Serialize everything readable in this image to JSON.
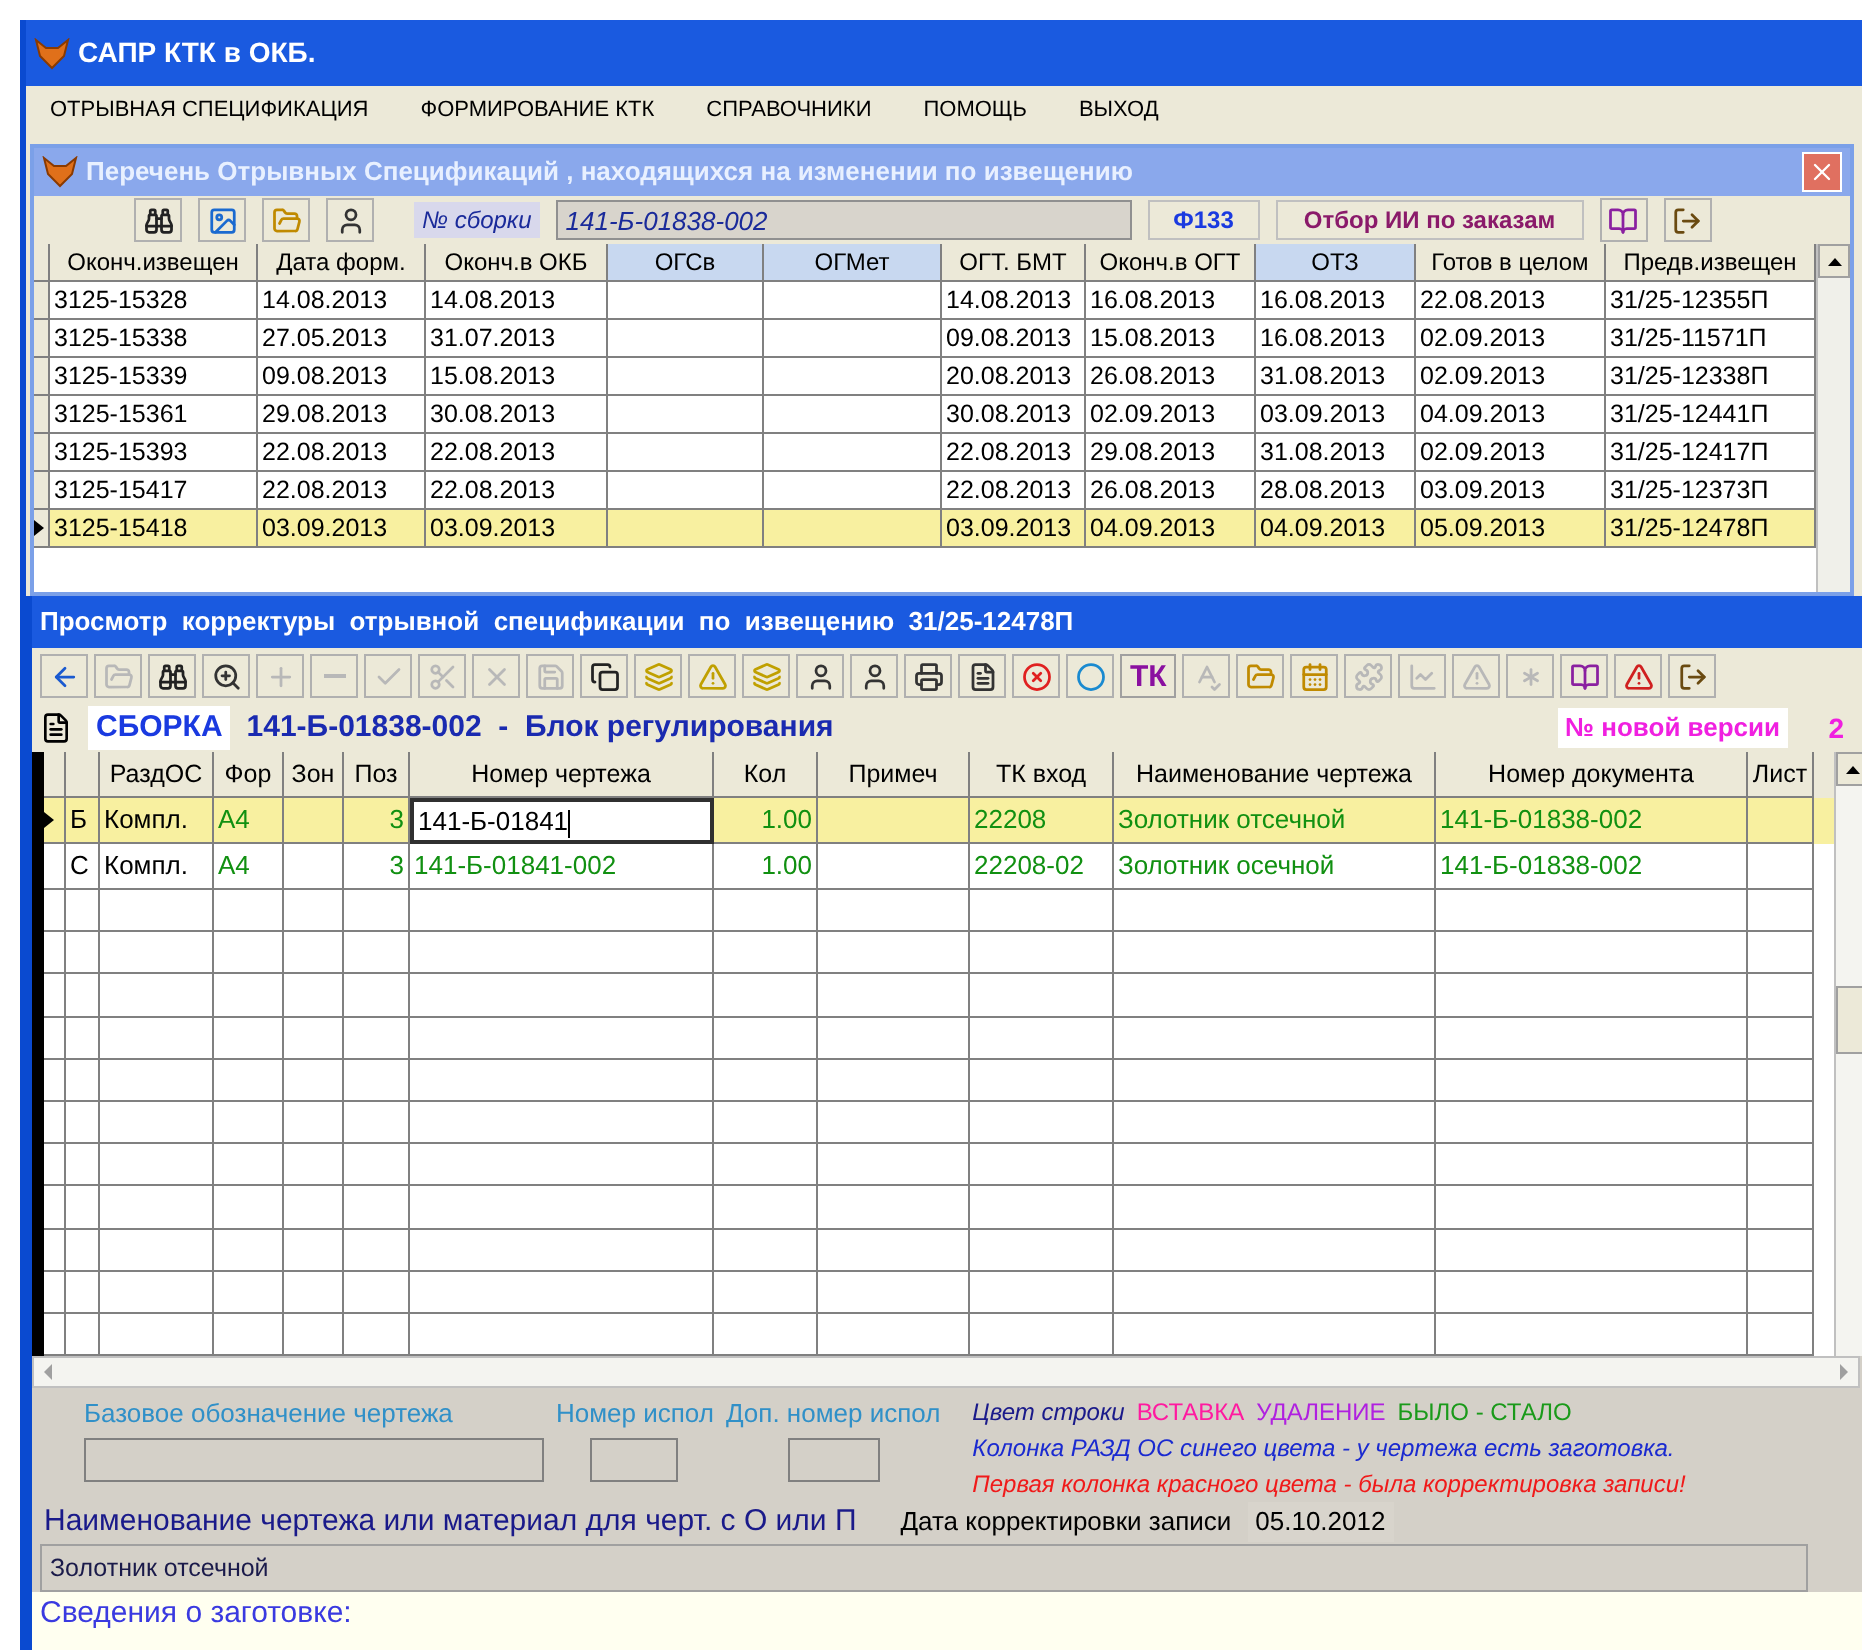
{
  "window": {
    "title": "САПР КТК в ОКБ."
  },
  "menu": [
    "ОТРЫВНАЯ СПЕЦИФИКАЦИЯ",
    "ФОРМИРОВАНИЕ КТК",
    "СПРАВОЧНИКИ",
    "ПОМОЩЬ",
    "ВЫХОД"
  ],
  "list_window": {
    "title": "Перечень Отрывных Спецификаций , находящихся на изменении по извещению",
    "toolbar": [
      {
        "kind": "binoculars",
        "disabled": false
      },
      {
        "kind": "picture",
        "disabled": false
      },
      {
        "kind": "folder",
        "disabled": false
      },
      {
        "kind": "person",
        "disabled": false
      }
    ],
    "assembly_label": "№ сборки",
    "assembly_value": "141-Б-01838-002",
    "form_button": "Ф133",
    "filter_button": "Отбор ИИ по заказам",
    "toolbar_right": [
      {
        "kind": "book",
        "disabled": false
      },
      {
        "kind": "exit",
        "disabled": false
      }
    ],
    "columns": [
      "Оконч.извещен",
      "Дата форм.",
      "Оконч.в ОКБ",
      "ОГСв",
      "ОГМет",
      "ОГТ. БМТ",
      "Оконч.в ОГТ",
      "ОТЗ",
      "Готов в целом",
      "Предв.извещен"
    ],
    "rows": [
      {
        "selected": false,
        "cells": [
          "3125-15328",
          "14.08.2013",
          "14.08.2013",
          "",
          "",
          "14.08.2013",
          "16.08.2013",
          "16.08.2013",
          "22.08.2013",
          "31/25-12355П"
        ]
      },
      {
        "selected": false,
        "cells": [
          "3125-15338",
          "27.05.2013",
          "31.07.2013",
          "",
          "",
          "09.08.2013",
          "15.08.2013",
          "16.08.2013",
          "02.09.2013",
          "31/25-11571П"
        ]
      },
      {
        "selected": false,
        "cells": [
          "3125-15339",
          "09.08.2013",
          "15.08.2013",
          "",
          "",
          "20.08.2013",
          "26.08.2013",
          "31.08.2013",
          "02.09.2013",
          "31/25-12338П"
        ]
      },
      {
        "selected": false,
        "cells": [
          "3125-15361",
          "29.08.2013",
          "30.08.2013",
          "",
          "",
          "30.08.2013",
          "02.09.2013",
          "03.09.2013",
          "04.09.2013",
          "31/25-12441П"
        ]
      },
      {
        "selected": false,
        "cells": [
          "3125-15393",
          "22.08.2013",
          "22.08.2013",
          "",
          "",
          "22.08.2013",
          "29.08.2013",
          "31.08.2013",
          "02.09.2013",
          "31/25-12417П"
        ]
      },
      {
        "selected": false,
        "cells": [
          "3125-15417",
          "22.08.2013",
          "22.08.2013",
          "",
          "",
          "22.08.2013",
          "26.08.2013",
          "28.08.2013",
          "03.09.2013",
          "31/25-12373П"
        ]
      },
      {
        "selected": true,
        "cells": [
          "3125-15418",
          "03.09.2013",
          "03.09.2013",
          "",
          "",
          "03.09.2013",
          "04.09.2013",
          "04.09.2013",
          "05.09.2013",
          "31/25-12478П"
        ]
      }
    ]
  },
  "view_window": {
    "title": "Просмотр  корректуры  отрывной  спецификации  по  извещению  31/25-12478П",
    "toolbar": [
      {
        "kind": "back",
        "disabled": false
      },
      {
        "kind": "folder",
        "disabled": true
      },
      {
        "kind": "binoculars",
        "disabled": false
      },
      {
        "kind": "zoom",
        "disabled": false
      },
      {
        "kind": "plus",
        "disabled": true
      },
      {
        "kind": "minus",
        "disabled": true
      },
      {
        "kind": "check",
        "disabled": true
      },
      {
        "kind": "scissors",
        "disabled": true
      },
      {
        "kind": "cross",
        "disabled": true
      },
      {
        "kind": "save",
        "disabled": true
      },
      {
        "kind": "windows",
        "disabled": false
      },
      {
        "kind": "layers",
        "disabled": false
      },
      {
        "kind": "warning",
        "disabled": false
      },
      {
        "kind": "layers",
        "disabled": false
      },
      {
        "kind": "person",
        "disabled": false
      },
      {
        "kind": "person",
        "disabled": false
      },
      {
        "kind": "printer",
        "disabled": false
      },
      {
        "kind": "document",
        "disabled": false
      },
      {
        "kind": "stop",
        "disabled": false
      },
      {
        "kind": "circle",
        "disabled": false
      },
      {
        "kind": "text",
        "label": "ТК",
        "disabled": false
      },
      {
        "kind": "spell",
        "disabled": true
      },
      {
        "kind": "folder",
        "disabled": false
      },
      {
        "kind": "calendar",
        "disabled": false
      },
      {
        "kind": "puzzle",
        "disabled": true
      },
      {
        "kind": "chart",
        "disabled": true
      },
      {
        "kind": "alert",
        "disabled": true
      },
      {
        "kind": "asterisk",
        "disabled": true
      },
      {
        "kind": "book",
        "disabled": false
      },
      {
        "kind": "alert",
        "disabled": false
      },
      {
        "kind": "exit",
        "disabled": false
      }
    ],
    "assembly_label": "СБОРКА",
    "assembly_title": "141-Б-01838-002  -  Блок регулирования",
    "version_label": "№ новой версии",
    "version_value": "2",
    "columns": [
      "",
      "РаздОС",
      "Фор",
      "Зон",
      "Поз",
      "Номер чертежа",
      "Кол",
      "Примеч",
      "ТК вход",
      "Наименование чертежа",
      "Номер документа",
      "Лист"
    ],
    "rows": [
      {
        "selected": true,
        "cells": [
          "Б",
          "Компл.",
          "А4",
          "",
          "3",
          "141-Б-01841",
          "1.00",
          "",
          "22208",
          "Золотник отсечной",
          "141-Б-01838-002",
          ""
        ]
      },
      {
        "selected": false,
        "cells": [
          "С",
          "Компл.",
          "А4",
          "",
          "3",
          "141-Б-01841-002",
          "1.00",
          "",
          "22208-02",
          "Золотник осечной",
          "141-Б-01838-002",
          ""
        ]
      }
    ],
    "base_label": "Базовое обозначение чертежа",
    "exec_label": "Номер испол",
    "extra_exec_label": "Доп. номер испол",
    "legend_label": "Цвет  строки",
    "legend": [
      {
        "text": "ВСТАВКА",
        "color": "#ff1aa0"
      },
      {
        "text": "УДАЛЕНИЕ",
        "color": "#b020e0"
      },
      {
        "text": "БЫЛО - СТАЛО",
        "color": "#1a9a1a"
      }
    ],
    "note_blue": "Колонка РАЗД ОС синего цвета - у чертежа есть заготовка.",
    "note_red": "Первая колонка  красного цвета - была корректировка записи!",
    "name_label": "Наименование чертежа или материал для черт. с О или П",
    "date_label": "Дата корректировки записи",
    "date_value": "05.10.2012",
    "name_value": "Золотник отсечной",
    "blank_label": "Сведения о заготовке:"
  }
}
